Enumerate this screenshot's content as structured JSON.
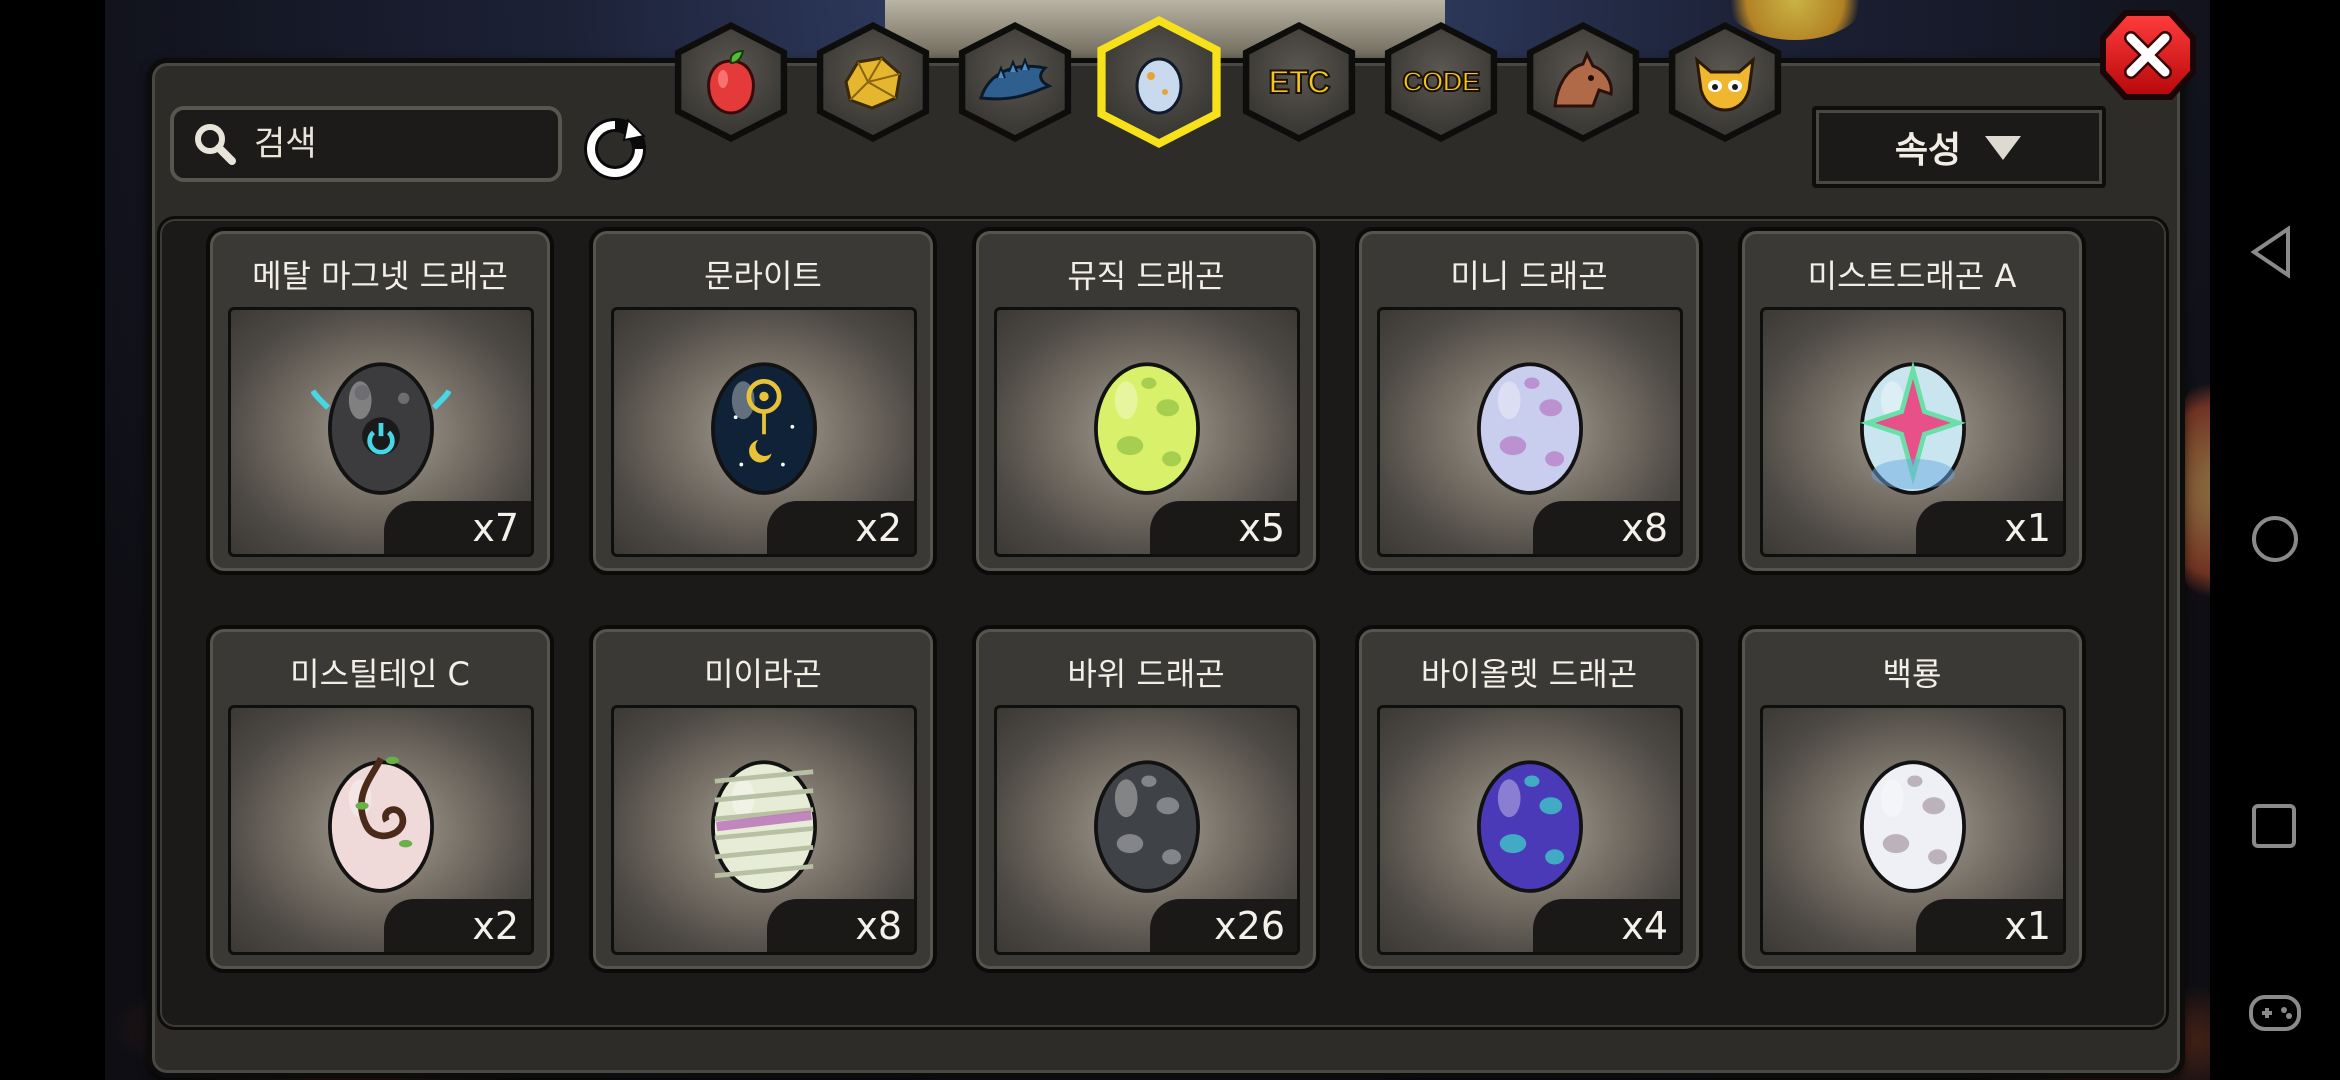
{
  "search": {
    "placeholder": "검색",
    "value": ""
  },
  "sort": {
    "label": "속성"
  },
  "tabs": [
    {
      "id": "fruit",
      "icon": "fruit-icon"
    },
    {
      "id": "gold",
      "icon": "gold-ore-icon"
    },
    {
      "id": "dragon",
      "icon": "dragon-icon"
    },
    {
      "id": "egg",
      "icon": "egg-icon",
      "active": true
    },
    {
      "id": "etc",
      "label": "ETC"
    },
    {
      "id": "code",
      "label": "CODE"
    },
    {
      "id": "beast",
      "icon": "beast-icon"
    },
    {
      "id": "pet",
      "icon": "pet-face-icon"
    }
  ],
  "eggs": [
    {
      "name": "메탈 마그넷 드래곤",
      "count": "x7",
      "base": "#3c3c3e",
      "spot": "#6f6f73",
      "style": "metal"
    },
    {
      "name": "문라이트",
      "count": "x2",
      "base": "#0f2238",
      "spot": "#e8c33a",
      "style": "moon"
    },
    {
      "name": "뮤직 드래곤",
      "count": "x5",
      "base": "#d9f06a",
      "spot": "#9ec94a",
      "style": "spots"
    },
    {
      "name": "미니 드래곤",
      "count": "x8",
      "base": "#c9cdee",
      "spot": "#b986c9",
      "style": "spots"
    },
    {
      "name": "미스트드래곤 A",
      "count": "x1",
      "base": "#c9e6f0",
      "spot": "#e8508a",
      "style": "cross"
    },
    {
      "name": "미스틸테인 C",
      "count": "x2",
      "base": "#f0d9d9",
      "spot": "#4a2a18",
      "style": "vine"
    },
    {
      "name": "미이라곤",
      "count": "x8",
      "base": "#e6ecd6",
      "spot": "#b96db9",
      "style": "wrap"
    },
    {
      "name": "바위 드래곤",
      "count": "x26",
      "base": "#3f4246",
      "spot": "#8f9196",
      "style": "spots"
    },
    {
      "name": "바이올렛 드래곤",
      "count": "x4",
      "base": "#4a3ab8",
      "spot": "#3fc0c8",
      "style": "spots"
    },
    {
      "name": "백룡",
      "count": "x1",
      "base": "#eef0f6",
      "spot": "#b3a7b0",
      "style": "spots"
    }
  ]
}
